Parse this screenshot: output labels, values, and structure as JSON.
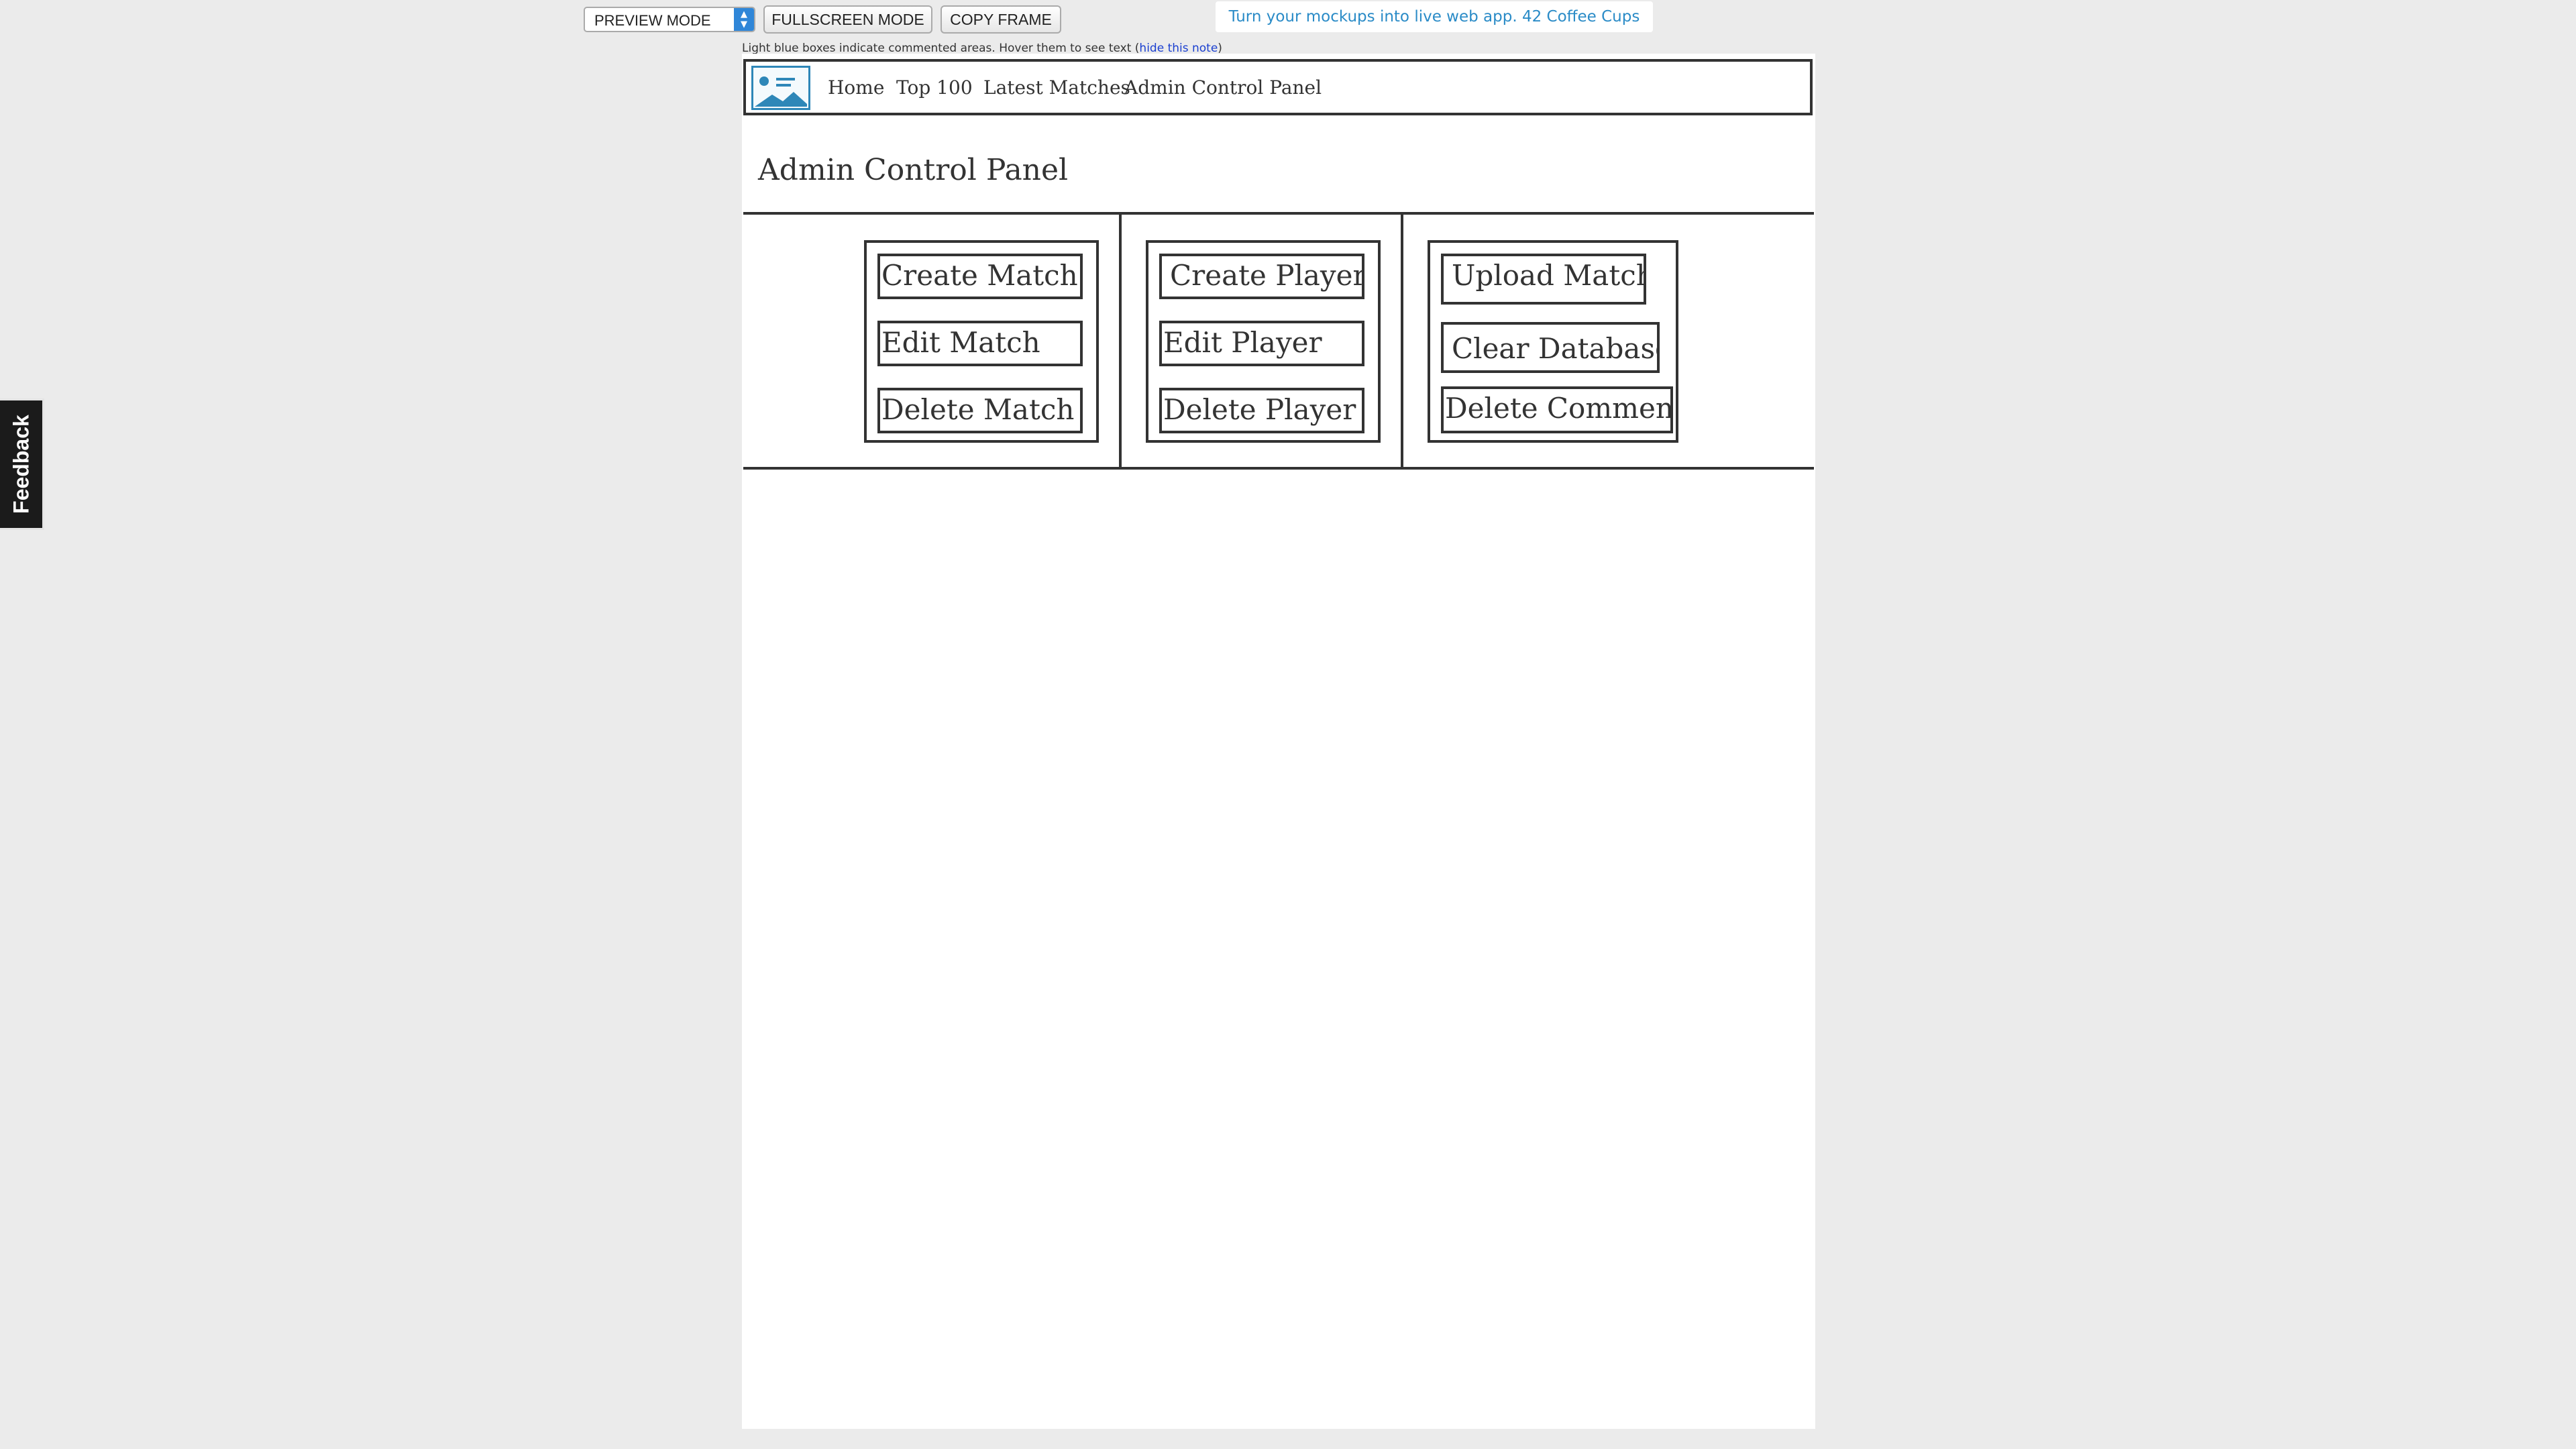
{
  "toolbar": {
    "mode_select": "PREVIEW MODE",
    "fullscreen_label": "FULLSCREEN MODE",
    "copy_frame_label": "COPY FRAME",
    "promo_text": "Turn your mockups into live web app. 42 Coffee Cups",
    "note_text": "Light blue boxes indicate commented areas. Hover them to see text ",
    "note_paren_open": "(",
    "note_link": "hide this note",
    "note_paren_close": ")"
  },
  "feedback": {
    "label": "Feedback"
  },
  "nav": {
    "items": [
      {
        "label": "Home"
      },
      {
        "label": "Top 100"
      },
      {
        "label": "Latest Matches"
      },
      {
        "label": "Admin Control Panel"
      }
    ]
  },
  "main": {
    "title": "Admin Control Panel",
    "groups": [
      {
        "buttons": [
          "Create Match",
          "Edit Match",
          "Delete Match"
        ]
      },
      {
        "buttons": [
          "Create Player",
          "Edit Player",
          "Delete Player"
        ]
      },
      {
        "buttons": [
          "Upload Match",
          "Clear Database",
          "Delete Comment"
        ]
      }
    ]
  },
  "colors": {
    "background": "#ebebeb",
    "canvas": "#ffffff",
    "wireframe_stroke": "#333333",
    "accent_blue": "#2a8bc7",
    "link_blue": "#1a3fd0"
  },
  "icons": {
    "logo": "image-placeholder-icon",
    "select_arrows": "chevron-up-down-icon"
  }
}
